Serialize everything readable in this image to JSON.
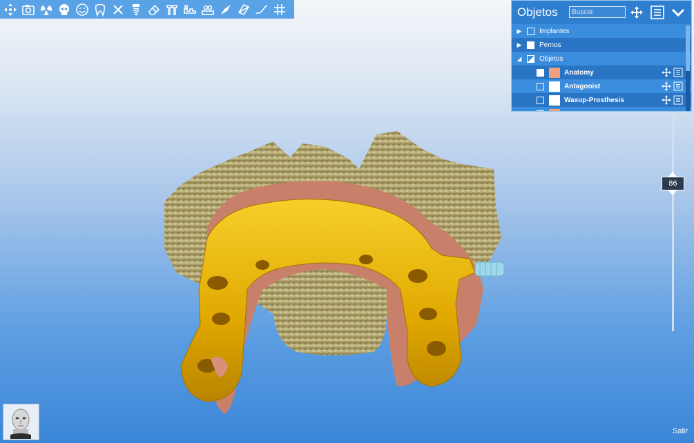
{
  "toolbar": {
    "icons": [
      "move-icon",
      "camera-icon",
      "radiation-icon",
      "skull-icon",
      "face-icon",
      "tooth-icon",
      "close-icon",
      "implant-screw-icon",
      "eraser-icon",
      "abutment-icon",
      "crown-bridge-icon",
      "arch-icon",
      "wax-knife-icon",
      "cut-plane-icon",
      "curve-icon",
      "grid-icon"
    ]
  },
  "panel": {
    "title": "Objetos",
    "search_placeholder": "Buscar",
    "groups": [
      {
        "label": "Implantes"
      },
      {
        "label": "Pernos"
      },
      {
        "label": "Objetos"
      }
    ],
    "items": [
      {
        "label": "Anatomy",
        "color": "#f0a07c"
      },
      {
        "label": "Antagonist",
        "color": "#ffffff"
      },
      {
        "label": "Waxup-Prosthesis",
        "color": "#ffffff"
      }
    ]
  },
  "slider": {
    "value": "86"
  },
  "footer": {
    "exit_label": "Salir"
  },
  "colors": {
    "accent": "#2f7fd1",
    "toolbar": "#5aa2e6",
    "bar": "#e0a800",
    "gum": "#c9806a",
    "bone": "#b9ad78"
  }
}
